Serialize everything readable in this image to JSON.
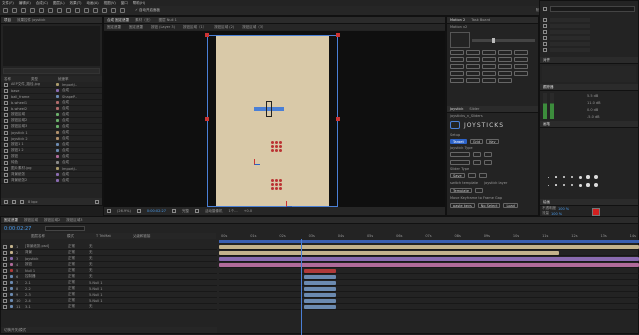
{
  "menu": [
    "文件(F)",
    "编辑(E)",
    "合成(C)",
    "图层(L)",
    "效果(T)",
    "动画(A)",
    "视图(V)",
    "窗口",
    "帮助(H)"
  ],
  "toolbar": {
    "snap_label": "✓ 自动开启面板",
    "workspace": [
      "默认",
      "了解",
      "标准",
      "小屏幕"
    ],
    "search_placeholder": "搜索帮助"
  },
  "project": {
    "tabs": [
      "项目",
      "效果控件 joystick"
    ],
    "columns": [
      "名称",
      "类型",
      "帧速率"
    ],
    "items": [
      {
        "name": "AEP文件_路径.jpg",
        "type": "ImportJ..",
        "color": "#a99a6b"
      },
      {
        "name": "base",
        "type": "合成",
        "color": "#8a6bb0"
      },
      {
        "name": "ball_frame",
        "type": "ShapeP..",
        "color": "#6b8ab0"
      },
      {
        "name": "b-wheel1",
        "type": "合成",
        "color": "#b06b6b"
      },
      {
        "name": "b-wheel2",
        "type": "合成",
        "color": "#b06b6b"
      },
      {
        "name": "按钮区域",
        "type": "合成",
        "color": "#6bb06b"
      },
      {
        "name": "按钮区域2",
        "type": "合成",
        "color": "#6bb06b"
      },
      {
        "name": "按钮区域3",
        "type": "合成",
        "color": "#6bb06b"
      },
      {
        "name": "joystick 1",
        "type": "合成",
        "color": "#b0906b"
      },
      {
        "name": "joystick 2",
        "type": "合成",
        "color": "#b0906b"
      },
      {
        "name": "按钮1 1",
        "type": "合成",
        "color": "#6b8ab0"
      },
      {
        "name": "按钮1 2",
        "type": "合成",
        "color": "#6b8ab0"
      },
      {
        "name": "按钮",
        "type": "合成",
        "color": "#b06b9a"
      },
      {
        "name": "纯色",
        "type": "合成",
        "color": "#8a8a8a"
      },
      {
        "name": "图片素材.jpg",
        "type": "ImportJ..",
        "color": "#a99a6b"
      },
      {
        "name": "背景纸张",
        "type": "合成",
        "color": "#8a6bb0"
      },
      {
        "name": "背景纸张2",
        "type": "合成",
        "color": "#8a6bb0"
      }
    ],
    "footer": "8 bpc"
  },
  "comp": {
    "tabs": [
      "合成 固定遮罩",
      "素材（无）",
      "图层 Null 1"
    ],
    "breadcrumbs": [
      "固定遮罩",
      "固定遮罩",
      "按钮 (Layer 3)",
      "按钮区域（1）",
      "按钮区域 (2)",
      "按钮区域（3）"
    ],
    "footer": {
      "zoom": "(26.9%)",
      "time": "0:00:02:27",
      "quality": "完整",
      "camera": "活动摄像机",
      "views": "1个...",
      "plus": "+0.0"
    }
  },
  "joystick": {
    "tabs": [
      "Motion 2",
      "Task Board"
    ],
    "motion_label": "Motion v2",
    "panel_tabs": [
      "Joystick",
      "Slider"
    ],
    "title": "joysticks_n_Sliders",
    "logo": "JOYSTICKS",
    "setup_label": "Setup",
    "buttons": [
      "Target",
      "Grid",
      "Key"
    ],
    "joystick_type": "Joystick Type",
    "slider_type": "Slider Type",
    "save_label": "Save",
    "switch_template": "switch template",
    "joystick_layer": "joystick layer",
    "template_btn": "Template",
    "move_label": "Move Keyframe to Frame Gap",
    "paste_keys": "paste keys",
    "no_select": "No Select",
    "load_btn": "Load"
  },
  "right": {
    "search": "搜索帮助",
    "props": [
      "字体",
      "属性",
      "字符"
    ],
    "align_title": "对齐",
    "effects_title": "画笔",
    "paint_title": "绘画",
    "opacity_label": "不透明度",
    "opacity_val": "100 %",
    "flow_label": "流量",
    "flow_val": "100 %",
    "mode_label": "模式",
    "mode_val": "正常",
    "channel_label": "通道",
    "channel_val": "RGBA",
    "tracker": "跟踪器",
    "duration_label": "持续时间",
    "clone_label": "仿制",
    "level_vals": [
      "5.5 dB",
      "11.0 dB",
      "0.0 dB",
      "-5.0 dB"
    ],
    "brush_color": "#d32020"
  },
  "timeline": {
    "tabs": [
      "固定遮罩",
      "按钮区域",
      "按钮区域2",
      "按钮区域3"
    ],
    "time": "0:00:02:27",
    "cols": [
      "图层名称",
      "模式",
      "T TrkMat",
      "父级和链接"
    ],
    "ruler": [
      "00s",
      "01s",
      "02s",
      "03s",
      "04s",
      "05s",
      "06s",
      "07s",
      "08s",
      "09s",
      "10s",
      "11s",
      "12s",
      "13s",
      "14s"
    ],
    "layers": [
      {
        "num": "1",
        "name": "[背景纸张.psd]",
        "mode": "正常",
        "parent": "无",
        "color": "#c4b38c"
      },
      {
        "num": "2",
        "name": "背景",
        "mode": "正常",
        "parent": "无",
        "color": "#c4b38c"
      },
      {
        "num": "3",
        "name": "Joystick",
        "mode": "正常",
        "parent": "无",
        "color": "#8a6bb0"
      },
      {
        "num": "4",
        "name": "按钮",
        "mode": "正常",
        "parent": "无",
        "color": "#b06b9a"
      },
      {
        "num": "5",
        "name": "Null 1",
        "mode": "正常",
        "parent": "无",
        "color": "#b03a3a"
      },
      {
        "num": "6",
        "name": "控制器",
        "mode": "正常",
        "parent": "无",
        "color": "#6b8ab0"
      },
      {
        "num": "7",
        "name": "2-1",
        "mode": "正常",
        "parent": "5.Null 1",
        "color": "#6b8ab0"
      },
      {
        "num": "8",
        "name": "2-2",
        "mode": "正常",
        "parent": "5.Null 1",
        "color": "#6b8ab0"
      },
      {
        "num": "9",
        "name": "2-3",
        "mode": "正常",
        "parent": "5.Null 1",
        "color": "#6b8ab0"
      },
      {
        "num": "10",
        "name": "2-4",
        "mode": "正常",
        "parent": "5.Null 1",
        "color": "#6b8ab0"
      },
      {
        "num": "11",
        "name": "3-1",
        "mode": "正常",
        "parent": "无",
        "color": "#6b8ab0"
      }
    ],
    "footer": "切换开关/模式"
  },
  "colors": {
    "bg": "#1d1d1d",
    "panel": "#232323",
    "accent": "#2d63c8",
    "paper": "#d9c9a8",
    "red": "#c33"
  }
}
